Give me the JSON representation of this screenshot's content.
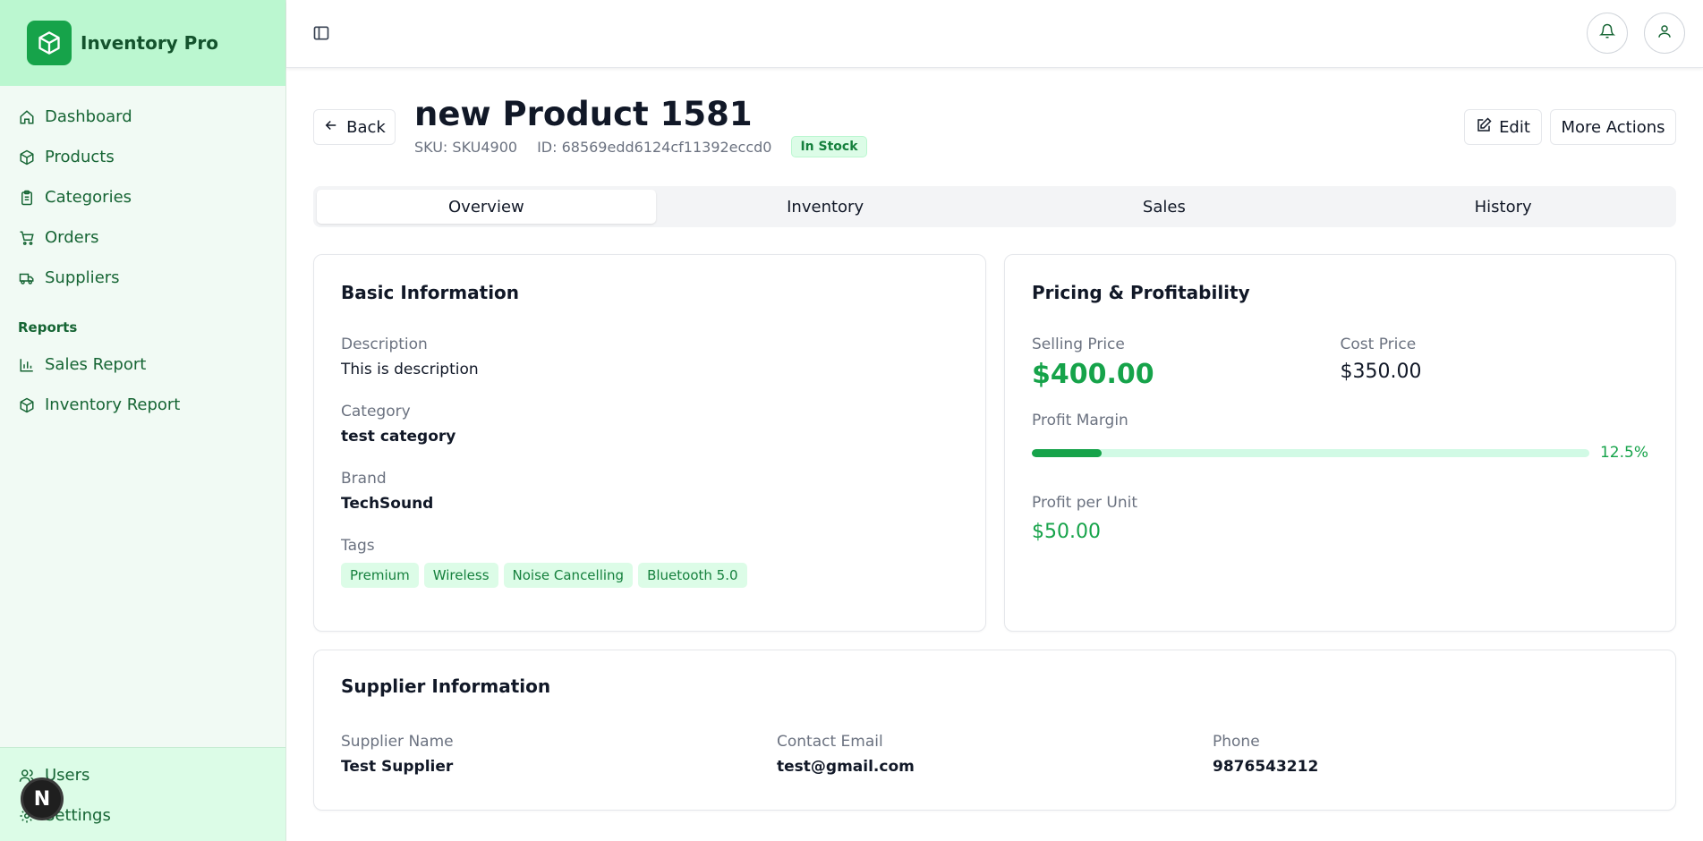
{
  "app": {
    "name": "Inventory Pro"
  },
  "sidebar": {
    "items": [
      {
        "label": "Dashboard"
      },
      {
        "label": "Products"
      },
      {
        "label": "Categories"
      },
      {
        "label": "Orders"
      },
      {
        "label": "Suppliers"
      }
    ],
    "reports_heading": "Reports",
    "report_items": [
      {
        "label": "Sales Report"
      },
      {
        "label": "Inventory Report"
      }
    ],
    "footer_items": [
      {
        "label": "Users"
      },
      {
        "label": "Settings"
      }
    ],
    "badge_letter": "N"
  },
  "header": {
    "back_label": "Back",
    "title": "new Product 1581",
    "sku": "SKU: SKU4900",
    "id": "ID: 68569edd6124cf11392eccd0",
    "status": "In Stock",
    "edit_label": "Edit",
    "more_label": "More Actions"
  },
  "tabs": [
    {
      "label": "Overview",
      "active": true
    },
    {
      "label": "Inventory"
    },
    {
      "label": "Sales"
    },
    {
      "label": "History"
    }
  ],
  "basic_info": {
    "title": "Basic Information",
    "description_label": "Description",
    "description": "This is description",
    "category_label": "Category",
    "category": "test category",
    "brand_label": "Brand",
    "brand": "TechSound",
    "tags_label": "Tags",
    "tags": [
      "Premium",
      "Wireless",
      "Noise Cancelling",
      "Bluetooth 5.0"
    ]
  },
  "pricing": {
    "title": "Pricing & Profitability",
    "selling_label": "Selling Price",
    "selling_price": "$400.00",
    "cost_label": "Cost Price",
    "cost_price": "$350.00",
    "margin_label": "Profit Margin",
    "margin_text": "12.5%",
    "margin_value": 12.5,
    "profit_label": "Profit per Unit",
    "profit_per_unit": "$50.00"
  },
  "supplier": {
    "title": "Supplier Information",
    "name_label": "Supplier Name",
    "name": "Test Supplier",
    "email_label": "Contact Email",
    "email": "test@gmail.com",
    "phone_label": "Phone",
    "phone": "9876543212"
  },
  "colors": {
    "accent": "#16a34a",
    "brand_bg": "#bbf7d0",
    "sidebar_bg": "#f1faf4"
  }
}
